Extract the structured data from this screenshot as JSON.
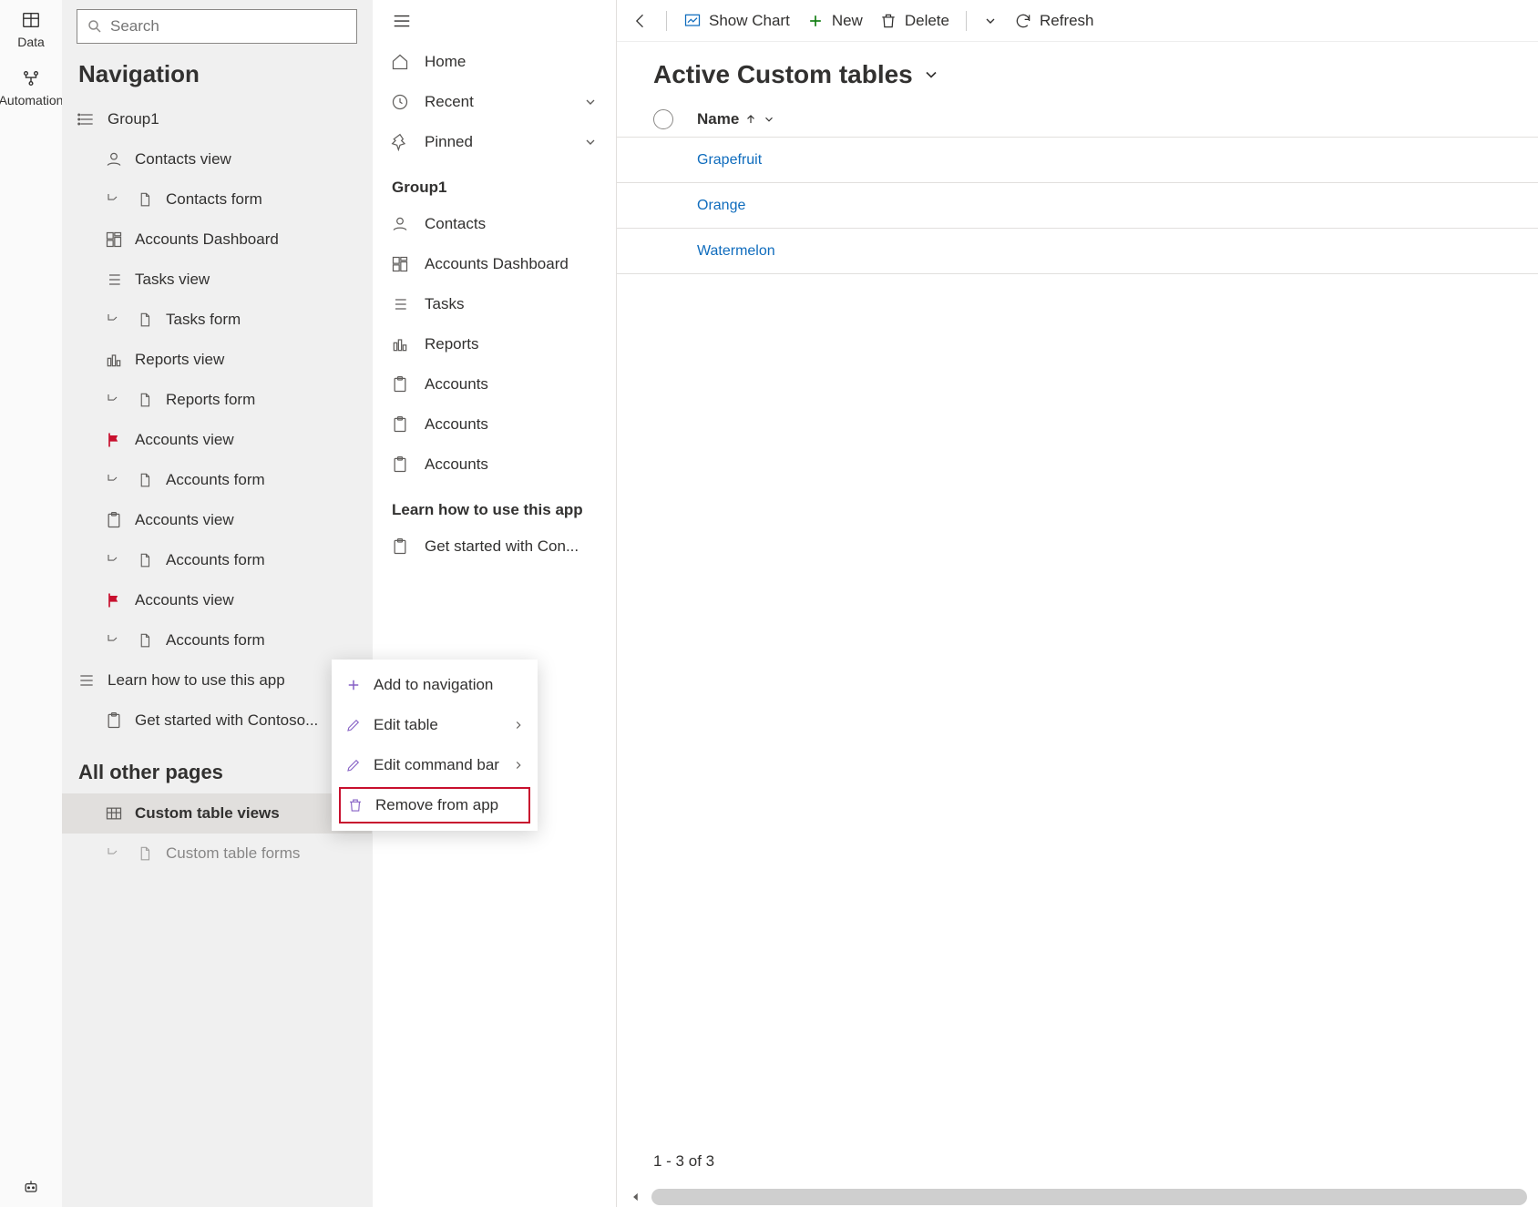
{
  "left_rail": {
    "data": "Data",
    "automation": "Automation"
  },
  "nav": {
    "search_placeholder": "Search",
    "title": "Navigation",
    "group1_label": "Group1",
    "items": {
      "contacts_view": "Contacts view",
      "contacts_form": "Contacts form",
      "accounts_dashboard": "Accounts Dashboard",
      "tasks_view": "Tasks view",
      "tasks_form": "Tasks form",
      "reports_view": "Reports view",
      "reports_form": "Reports form",
      "accounts_view1": "Accounts view",
      "accounts_form1": "Accounts form",
      "accounts_view2": "Accounts view",
      "accounts_form2": "Accounts form",
      "accounts_view3": "Accounts view",
      "accounts_form3": "Accounts form"
    },
    "learn_label": "Learn how to use this app",
    "get_started": "Get started with Contoso...",
    "other_pages": "All other pages",
    "custom_views": "Custom table views",
    "custom_forms": "Custom table forms"
  },
  "sidebar": {
    "home": "Home",
    "recent": "Recent",
    "pinned": "Pinned",
    "group": "Group1",
    "contacts": "Contacts",
    "acc_dash": "Accounts Dashboard",
    "tasks": "Tasks",
    "reports": "Reports",
    "accounts1": "Accounts",
    "accounts2": "Accounts",
    "accounts3": "Accounts",
    "learn": "Learn how to use this app",
    "getstarted": "Get started with Con..."
  },
  "cmd": {
    "show_chart": "Show Chart",
    "new": "New",
    "delete": "Delete",
    "refresh": "Refresh"
  },
  "view": {
    "title": "Active Custom tables",
    "col_name": "Name",
    "rows": {
      "0": "Grapefruit",
      "1": "Orange",
      "2": "Watermelon"
    },
    "footer": "1 - 3 of 3"
  },
  "ctx": {
    "add_nav": "Add to navigation",
    "edit_table": "Edit table",
    "edit_cmd": "Edit command bar",
    "remove": "Remove from app"
  }
}
